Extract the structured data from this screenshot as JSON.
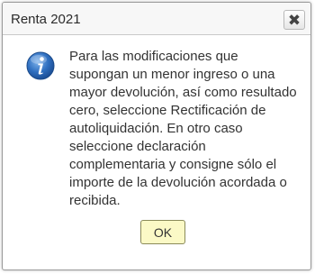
{
  "dialog": {
    "title": "Renta 2021",
    "close_icon": "close-icon",
    "info_icon": "info-icon",
    "message": "Para las modificaciones que supongan un menor ingreso o una mayor devolución, así como resultado cero, seleccione Rectificación de autoliquidación. En otro caso seleccione declaración complementaria y consigne sólo el importe de la devolución acordada o recibida.",
    "ok_label": "OK"
  },
  "colors": {
    "titlebar_bg": "#f7f7f7",
    "ok_button_bg": "#fbf9c6",
    "info_icon_blue": "#2f6fc0",
    "text": "#333333"
  }
}
